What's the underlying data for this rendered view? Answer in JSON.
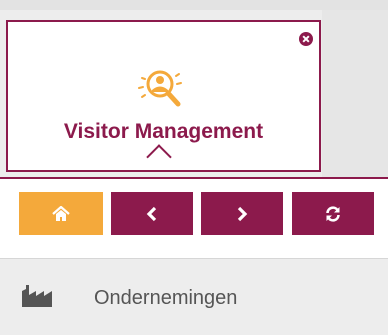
{
  "colors": {
    "brand": "#8c1a4c",
    "home_accent": "#f4a93b",
    "menu_text": "#555555"
  },
  "app_card": {
    "title": "Visitor Management",
    "icon": "visitor-search-icon",
    "close_icon": "close-icon"
  },
  "toolbar": {
    "home_icon": "home-icon",
    "back_icon": "chevron-left-icon",
    "forward_icon": "chevron-right-icon",
    "refresh_icon": "refresh-icon"
  },
  "menu": {
    "items": [
      {
        "label": "Ondernemingen",
        "icon": "factory-icon"
      }
    ]
  }
}
